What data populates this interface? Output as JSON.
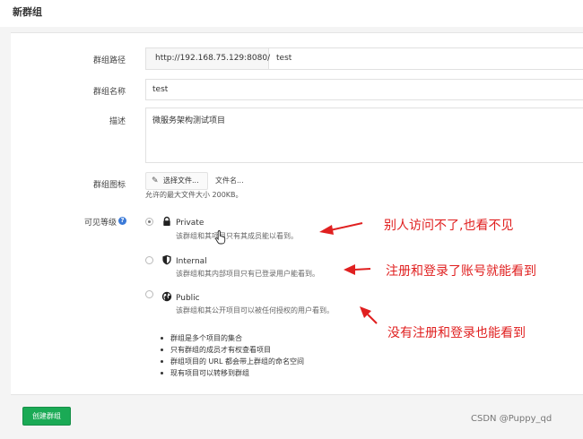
{
  "page": {
    "title": "新群组"
  },
  "form": {
    "path_label": "群组路径",
    "path_prefix": "http://192.168.75.129:8080/",
    "path_value": "test",
    "name_label": "群组名称",
    "name_value": "test",
    "desc_label": "描述",
    "desc_value": "微服务架构测试项目",
    "avatar_label": "群组图标",
    "file_button": "选择文件...",
    "file_name": "文件名...",
    "file_hint": "允许的最大文件大小 200KB。",
    "visibility_label": "可见等级",
    "visibility_options": [
      {
        "title": "Private",
        "description": "该群组和其项目只有其成员能以看到。",
        "icon": "lock-icon",
        "checked": true
      },
      {
        "title": "Internal",
        "description": "该群组和其内部项目只有已登录用户能看到。",
        "icon": "shield-icon",
        "checked": false
      },
      {
        "title": "Public",
        "description": "该群组和其公开项目可以被任何授权的用户看到。",
        "icon": "globe-icon",
        "checked": false
      }
    ],
    "notes": [
      "群组是多个项目的集合",
      "只有群组的成员才有权查看项目",
      "群组项目的 URL 都会带上群组的命名空间",
      "现有项目可以转移到群组"
    ],
    "create_button": "创建群组"
  },
  "annotations": [
    "别人访问不了,也看不见",
    "注册和登录了账号就能看到",
    "没有注册和登录也能看到"
  ],
  "watermark": "CSDN @Puppy_qd",
  "colors": {
    "accent_green": "#1aaa55",
    "annotation_red": "#e02020",
    "help_blue": "#3b7ad8"
  }
}
